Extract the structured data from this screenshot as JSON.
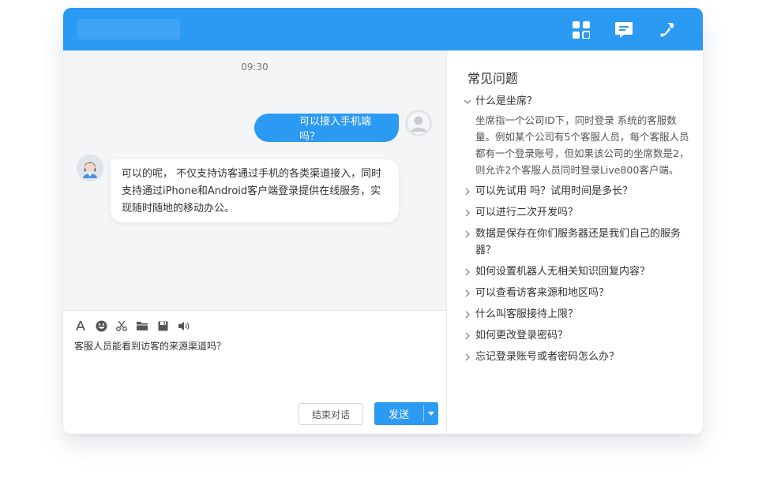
{
  "chat": {
    "timestamp": "09:30",
    "outgoing_message": "可以接入手机端吗？",
    "incoming_message": "可以的呢，       不仅支持访客通过手机的各类渠道接入，同时支持通过iPhone和Android客户端登录提供在线服务，实现随时随地的移动办公。",
    "input_value": "客服人员能看到访客的来源渠道吗？"
  },
  "actions": {
    "end_label": "结束对话",
    "send_label": "发送"
  },
  "icons": {
    "header": [
      "apps-grid-icon",
      "chat-icon",
      "phone-icon"
    ],
    "toolbar": [
      "font-icon",
      "emoji-icon",
      "scissors-icon",
      "folder-icon",
      "save-icon",
      "volume-icon"
    ]
  },
  "colors": {
    "brand_blue": "#2b9af3",
    "chat_bg": "#f4f5f7"
  },
  "faq": {
    "title": "常见问题",
    "items": [
      {
        "q": "什么是坐席？",
        "expanded": true,
        "a": "坐席指一个公司ID下，同时登录        系统的客服数量。例如某个公司有5个客服人员，每个客服人员都有一个登录账号，但如果该公司的坐席数是2，则允许2个客服人员同时登录Live800客户端。"
      },
      {
        "q": "可以先试用         吗？试用时间是多长？"
      },
      {
        "q": "         可以进行二次开发吗？"
      },
      {
        "q": "数据是保存在你们服务器还是我们自己的服务器？"
      },
      {
        "q": " 如何设置机器人无相关知识回复内容？"
      },
      {
        "q": "可以查看访客来源和地区吗？"
      },
      {
        "q": "什么叫客服接待上限？"
      },
      {
        "q": "如何更改登录密码？"
      },
      {
        "q": "忘记登录账号或者密码怎么办？"
      }
    ]
  }
}
